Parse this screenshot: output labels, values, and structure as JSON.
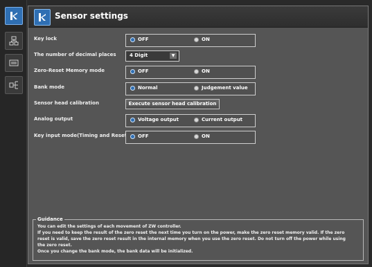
{
  "panel": {
    "title": "Sensor settings"
  },
  "rail": {
    "items": [
      "sensor-settings",
      "network",
      "display",
      "io"
    ]
  },
  "settings": {
    "key_lock": {
      "label": "Key lock",
      "options": [
        "OFF",
        "ON"
      ],
      "selected": "OFF"
    },
    "decimal": {
      "label": "The number of decimal places",
      "value": "4 Digit"
    },
    "zero_reset": {
      "label": "Zero-Reset Memory mode",
      "options": [
        "OFF",
        "ON"
      ],
      "selected": "OFF"
    },
    "bank_mode": {
      "label": "Bank mode",
      "options": [
        "Normal",
        "Judgement value"
      ],
      "selected": "Normal"
    },
    "sensor_head": {
      "label": "Sensor head calibration",
      "button": "Execute sensor head calibration"
    },
    "analog": {
      "label": "Analog output",
      "options": [
        "Voltage output",
        "Current output"
      ],
      "selected": "Voltage output"
    },
    "key_input": {
      "label": "Key input mode(Timing and Reset)",
      "options": [
        "OFF",
        "ON"
      ],
      "selected": "OFF"
    }
  },
  "guidance": {
    "title": "Guidance",
    "lines": [
      "You can edit the settings of each movement of ZW controller.",
      "If you need to keep the result of the zero reset the next time you turn on the power, make the zero reset memory valid. If the zero",
      "reset is valid, save the zero reset result in the internal memory when you use the zero reset. Do not turn off the power while using",
      "the zero reset.",
      "Once you change the bank mode, the bank data will be initialized."
    ]
  }
}
